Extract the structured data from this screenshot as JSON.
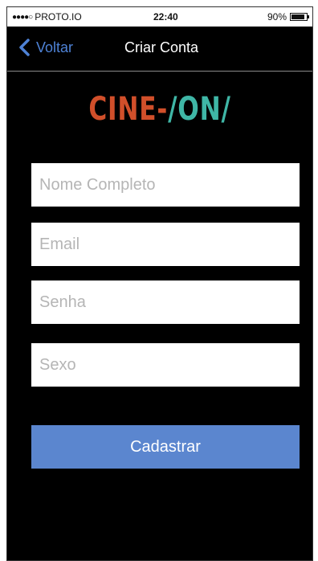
{
  "status_bar": {
    "carrier": "PROTO.IO",
    "time": "22:40",
    "battery_percent": "90%",
    "battery_level": 0.9
  },
  "nav": {
    "back_label": "Voltar",
    "title": "Criar Conta"
  },
  "logo": {
    "part1": "CINE-",
    "part2": "/ON/"
  },
  "form": {
    "full_name_placeholder": "Nome Completo",
    "email_placeholder": "Email",
    "password_placeholder": "Senha",
    "sex_placeholder": "Sexo",
    "submit_label": "Cadastrar"
  },
  "colors": {
    "background": "#000000",
    "accent_blue": "#5b86cf",
    "link_blue": "#4e82d6",
    "logo_orange": "#d14f2a",
    "logo_teal": "#3fb6a6"
  }
}
